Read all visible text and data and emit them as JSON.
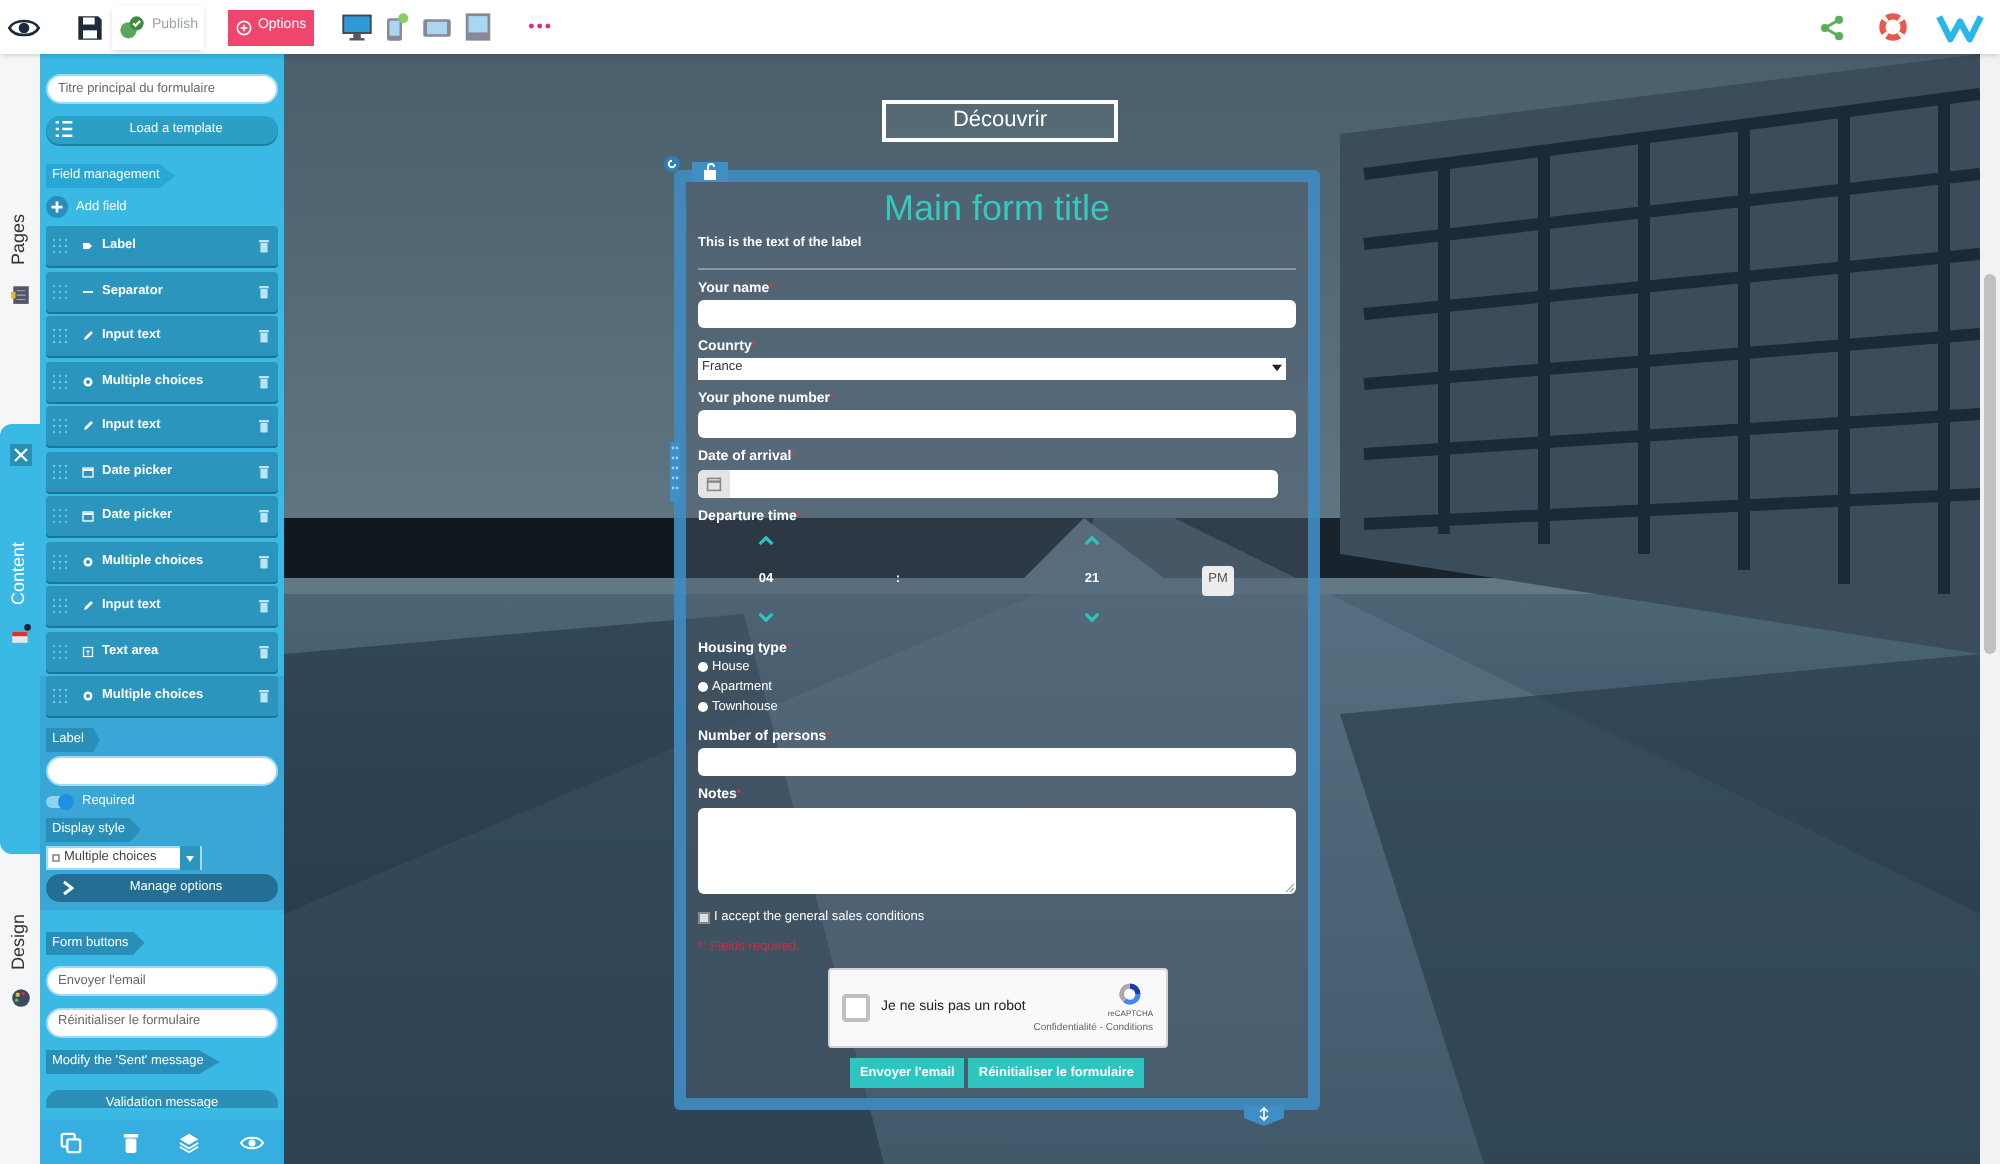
{
  "toolbar": {
    "publish": "Publish",
    "options": "Options",
    "devices": [
      {
        "kind": "desktop"
      },
      {
        "kind": "tablet"
      },
      {
        "kind": "landscape"
      },
      {
        "kind": "screen"
      }
    ],
    "more": "•••"
  },
  "side_tabs": [
    {
      "label": "Pages",
      "selected": false
    },
    {
      "label": "Content",
      "selected": true
    },
    {
      "label": "Design",
      "selected": false
    }
  ],
  "panel": {
    "title_value": "Titre principal du formulaire",
    "load_template": "Load a template",
    "field_heading": "Field management",
    "add_field": "Add field",
    "fields": [
      {
        "kind": "label",
        "label": "Label",
        "expanded": false
      },
      {
        "kind": "separator",
        "label": "Separator",
        "expanded": false
      },
      {
        "kind": "input",
        "label": "Input text",
        "expanded": false
      },
      {
        "kind": "choices",
        "label": "Multiple choices",
        "expanded": false
      },
      {
        "kind": "input",
        "label": "Input text",
        "expanded": false
      },
      {
        "kind": "date",
        "label": "Date picker",
        "expanded": false
      },
      {
        "kind": "date",
        "label": "Date picker",
        "expanded": false
      },
      {
        "kind": "choices",
        "label": "Multiple choices",
        "expanded": false
      },
      {
        "kind": "input",
        "label": "Input text",
        "expanded": false
      },
      {
        "kind": "textarea",
        "label": "Text area",
        "expanded": false
      },
      {
        "kind": "choices",
        "label": "Multiple choices",
        "expanded": true
      }
    ],
    "options": {
      "label_heading": "Label",
      "required_label": "Required",
      "required_on": true,
      "display_heading": "Display style",
      "display_value": "Multiple choices",
      "manage": "Manage options"
    },
    "buttons_heading": "Form buttons",
    "button_values": [
      "Envoyer l'email",
      "Réinitialiser le formulaire"
    ],
    "sent_heading": "Modify the 'Sent' message",
    "validation": "Validation message"
  },
  "canvas": {
    "discover": "Découvrir",
    "form": {
      "title": "Main form title",
      "intro": "This is the text of the label",
      "fields": [
        {
          "kind": "text",
          "label": "Your name",
          "mark": "*"
        },
        {
          "kind": "select",
          "label": "Counrty",
          "mark": "*",
          "value": "France"
        },
        {
          "kind": "text",
          "label": "Your phone number",
          "mark": "*"
        },
        {
          "kind": "date",
          "label": "Date of arrival",
          "mark": "*"
        },
        {
          "kind": "time",
          "label": "Departure time",
          "mark": "*",
          "hours": "04",
          "separator": ":",
          "minutes": "21",
          "period": "PM"
        },
        {
          "kind": "radio",
          "label": "Housing type",
          "mark": "*",
          "choices": [
            {
              "label": "House",
              "selected": false
            },
            {
              "label": "Apartment",
              "selected": false
            },
            {
              "label": "Townhouse",
              "selected": false
            }
          ]
        },
        {
          "kind": "text",
          "label": "Number of persons",
          "mark": "*"
        },
        {
          "kind": "textarea",
          "label": "Notes",
          "mark": "*"
        }
      ],
      "consent": "I accept the general sales conditions",
      "consent_checked": false,
      "required_note": "*: Fields required.",
      "captcha": {
        "checked": false,
        "label": "Je ne suis pas un robot",
        "brand": "reCAPTCHA",
        "links": "Confidentialité - Conditions"
      },
      "buttons": [
        "Envoyer l'email",
        "Réinitialiser le formulaire"
      ]
    }
  }
}
